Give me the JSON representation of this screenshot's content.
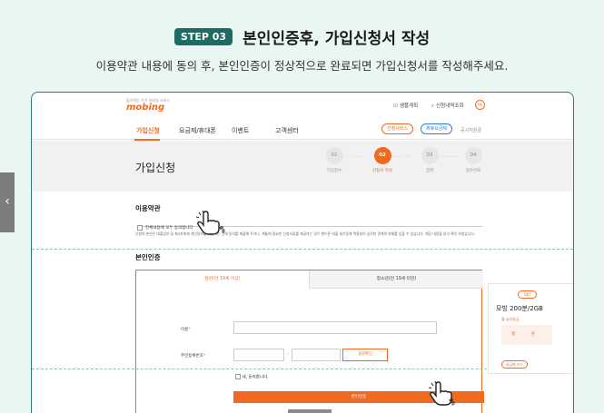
{
  "header": {
    "step_badge": "STEP 03",
    "title": "본인인증후, 가입신청서 작성",
    "description": "이용약관 내용에 동의 후, 본인인증이 정상적으로 완료되면 가입신청서를 작성해주세요."
  },
  "site": {
    "logo_tagline": "합리적인 가격 모바일 서비스",
    "logo": "mobing",
    "top_links": [
      "샘플계획",
      "신청내역조회"
    ],
    "top_icon": "채팅",
    "nav": [
      "가입신청",
      "요금제/휴대폰",
      "이벤트",
      "고객센터"
    ],
    "pills": [
      "신청서비스",
      "제휴요금제"
    ],
    "nav_small": "공시지원금"
  },
  "hero": {
    "page_title": "가입신청",
    "steps": [
      {
        "num": "01",
        "label": "가입접수"
      },
      {
        "num": "02",
        "label": "신청서 작성"
      },
      {
        "num": "03",
        "label": "결제"
      },
      {
        "num": "04",
        "label": "접수완료"
      }
    ]
  },
  "terms": {
    "title": "이용약관",
    "agree_all": "전체내용에 모두 동의합니다",
    "text": "신청의 본인은 대출업자 및 제3자에게 개인정보를 제공하는 것에 동의를 제출해 주거나, 계통에 필요한 신청서류를 제공하는 경우 밴드폰 대출 세기동에 맥용되어 심각한 관계의 위해를 입을 수 있습니다. 해당 내용을 읽고 확인 하였습니다."
  },
  "auth": {
    "title": "본인인증",
    "tab_adult": "일반(만 19세 이상)",
    "tab_youth": "청소년(만 19세 미만)",
    "name_label": "이름",
    "rrn_label": "주민등록번호",
    "verify_button": "실명확인",
    "consent": "네, 동의합니다.",
    "submit_button": "본인인증"
  },
  "plan": {
    "carrier": "SKT",
    "name": "모빙 200분/2GB",
    "sub": "월 납부요금",
    "price": "월 원",
    "more": "요금제 보기"
  },
  "hand_label": "클릭",
  "colors": {
    "accent": "#f06a22",
    "step_badge": "#1d6b63",
    "background": "#e9f6f3"
  }
}
